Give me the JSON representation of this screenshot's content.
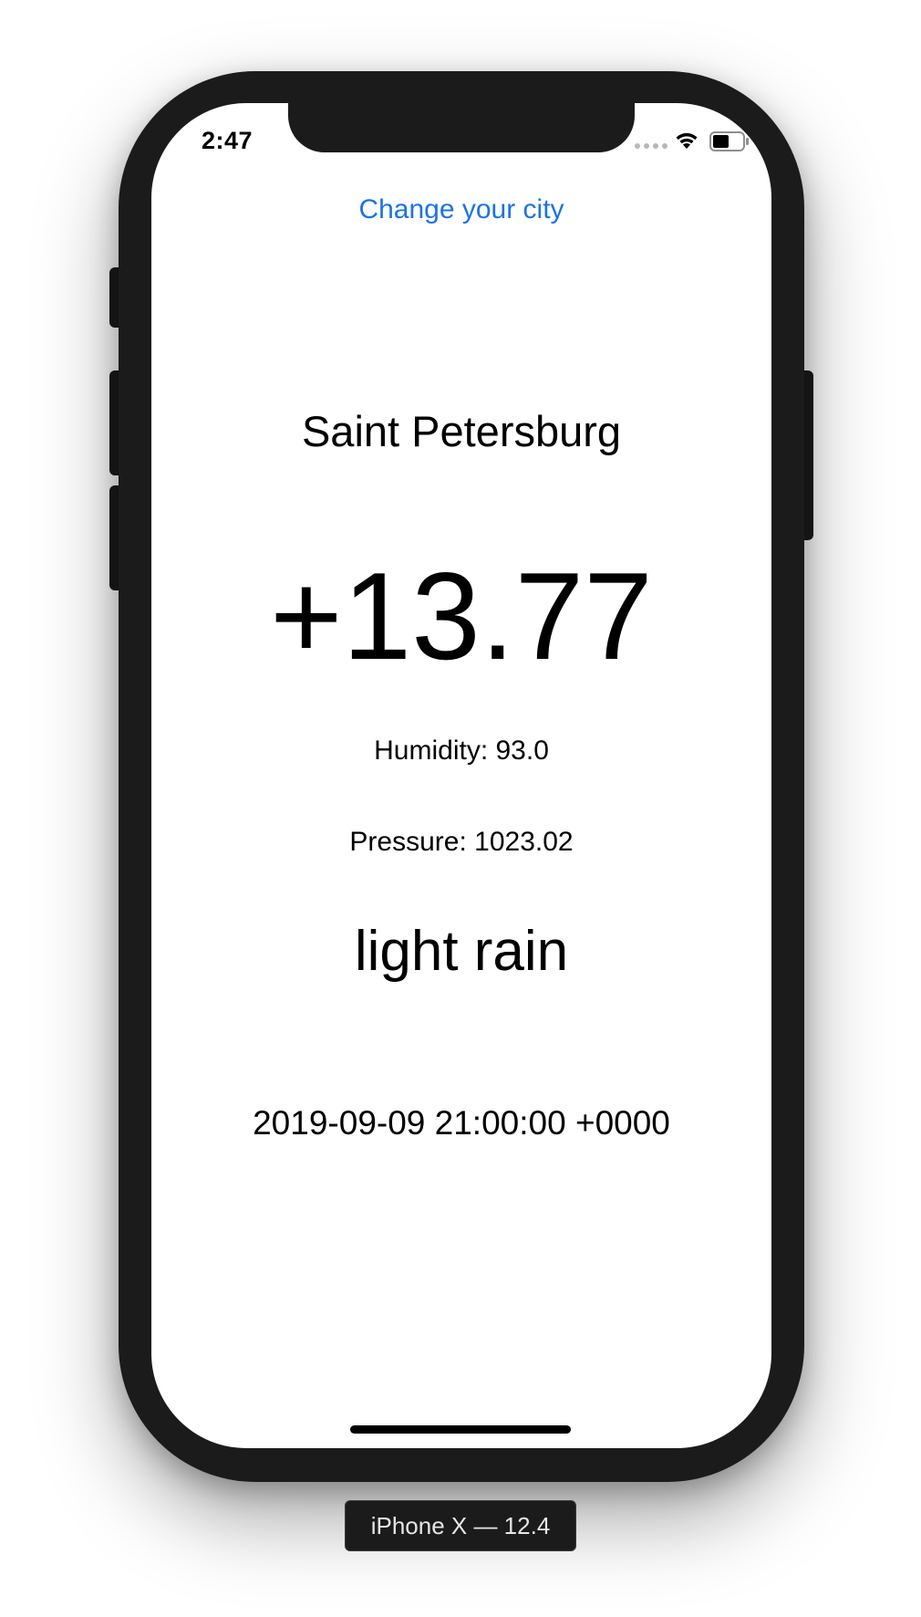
{
  "status_bar": {
    "time": "2:47"
  },
  "header": {
    "change_city_label": "Change your city"
  },
  "weather": {
    "city": "Saint Petersburg",
    "temperature": "+13.77",
    "humidity": "Humidity: 93.0",
    "pressure": "Pressure: 1023.02",
    "description": "light rain",
    "datetime": "2019-09-09 21:00:00 +0000"
  },
  "simulator": {
    "device_label": "iPhone X — 12.4"
  },
  "colors": {
    "accent": "#1a73e8",
    "device_body": "#1b1b1b",
    "text": "#000000"
  }
}
